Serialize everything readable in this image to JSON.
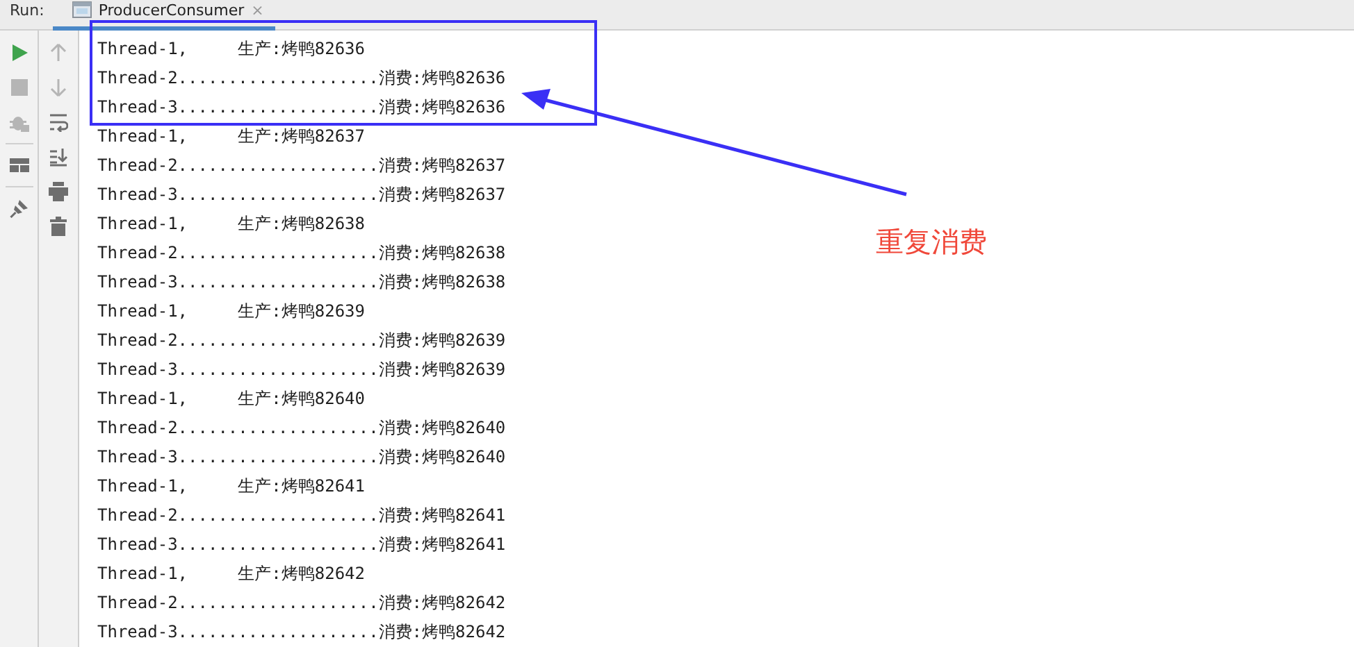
{
  "run_label": "Run:",
  "tab": {
    "title": "ProducerConsumer",
    "close": "×",
    "selected": true
  },
  "toolbar_left": [
    {
      "kind": "run",
      "disabled": false
    },
    {
      "kind": "stop",
      "disabled": true
    },
    {
      "kind": "debug",
      "disabled": true
    },
    {
      "kind": "layout",
      "disabled": false
    },
    {
      "kind": "pin",
      "disabled": false
    }
  ],
  "toolbar_right": [
    {
      "kind": "up",
      "disabled": true
    },
    {
      "kind": "down",
      "disabled": true
    },
    {
      "kind": "wrap",
      "disabled": false
    },
    {
      "kind": "scroll",
      "disabled": false
    },
    {
      "kind": "print",
      "disabled": false
    },
    {
      "kind": "trash",
      "disabled": false
    }
  ],
  "console_lines": [
    "Thread-1,     生产:烤鸭82636",
    "Thread-2....................消费:烤鸭82636",
    "Thread-3....................消费:烤鸭82636",
    "Thread-1,     生产:烤鸭82637",
    "Thread-2....................消费:烤鸭82637",
    "Thread-3....................消费:烤鸭82637",
    "Thread-1,     生产:烤鸭82638",
    "Thread-2....................消费:烤鸭82638",
    "Thread-3....................消费:烤鸭82638",
    "Thread-1,     生产:烤鸭82639",
    "Thread-2....................消费:烤鸭82639",
    "Thread-3....................消费:烤鸭82639",
    "Thread-1,     生产:烤鸭82640",
    "Thread-2....................消费:烤鸭82640",
    "Thread-3....................消费:烤鸭82640",
    "Thread-1,     生产:烤鸭82641",
    "Thread-2....................消费:烤鸭82641",
    "Thread-3....................消费:烤鸭82641",
    "Thread-1,     生产:烤鸭82642",
    "Thread-2....................消费:烤鸭82642",
    "Thread-3....................消费:烤鸭82642"
  ],
  "annotation": {
    "label": "重复消费"
  }
}
